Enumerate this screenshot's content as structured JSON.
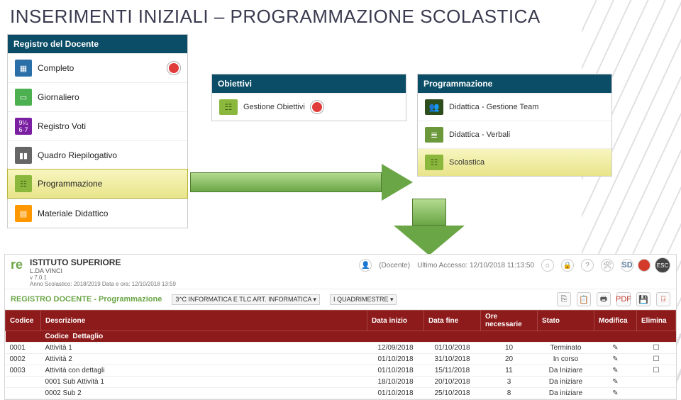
{
  "title": "INSERIMENTI INIZIALI – PROGRAMMAZIONE SCOLASTICA",
  "left_panel": {
    "header": "Registro del Docente",
    "items": [
      {
        "label": "Completo",
        "icon": "cal",
        "new": true
      },
      {
        "label": "Giornaliero",
        "icon": "day"
      },
      {
        "label": "Registro Voti",
        "icon": "v94"
      },
      {
        "label": "Quadro Riepilogativo",
        "icon": "bars"
      },
      {
        "label": "Programmazione",
        "icon": "tree",
        "selected": true
      },
      {
        "label": "Materiale Didattico",
        "icon": "mat"
      }
    ]
  },
  "obiettivi": {
    "header": "Obiettivi",
    "items": [
      {
        "label": "Gestione Obiettivi",
        "icon": "tree",
        "new": true
      }
    ]
  },
  "programmazione": {
    "header": "Programmazione",
    "items": [
      {
        "label": "Didattica - Gestione Team",
        "icon": "team"
      },
      {
        "label": "Didattica - Verbali",
        "icon": "doc"
      },
      {
        "label": "Scolastica",
        "icon": "tree",
        "selected": true
      }
    ]
  },
  "app": {
    "logo": "re",
    "institute": "ISTITUTO SUPERIORE",
    "institute_sub": "L.DA VINCI",
    "version": "v 7.0.1",
    "year_label": "Anno Scolastico: 2018/2019  Data e ora: 12/10/2018 13:59",
    "user_role": "(Docente)",
    "last_access": "Ultimo Accesso: 12/10/2018 11:13:50",
    "top_right": {
      "sd": "SD",
      "esc": "ESC"
    },
    "breadcrumb": "REGISTRO DOCENTE - Programmazione",
    "class_select": "3^C INFORMATICA E TLC ART. INFORMATICA",
    "period": "I QUADRIMESTRE",
    "cols": [
      "Codice",
      "Descrizione",
      "Data inizio",
      "Data fine",
      "Ore necessarie",
      "Stato",
      "Modifica",
      "Elimina"
    ],
    "subcols": [
      "Codice",
      "Dettaglio"
    ],
    "rows": [
      {
        "cod": "0001",
        "desc": "Attività 1",
        "di": "12/09/2018",
        "df": "01/10/2018",
        "ore": "10",
        "stato": "Terminato",
        "mod": "✎",
        "del": "☐"
      },
      {
        "cod": "0002",
        "desc": "Attività 2",
        "di": "01/10/2018",
        "df": "31/10/2018",
        "ore": "20",
        "stato": "In corso",
        "mod": "✎",
        "del": "☐"
      },
      {
        "cod": "0003",
        "desc": "Attività con dettagli",
        "di": "01/10/2018",
        "df": "15/11/2018",
        "ore": "11",
        "stato": "Da Iniziare",
        "mod": "✎",
        "del": "☐"
      },
      {
        "cod": "",
        "desc": "0001   Sub Attività 1",
        "di": "18/10/2018",
        "df": "20/10/2018",
        "ore": "3",
        "stato": "Da iniziare",
        "mod": "✎",
        "del": ""
      },
      {
        "cod": "",
        "desc": "0002   Sub 2",
        "di": "01/10/2018",
        "df": "25/10/2018",
        "ore": "8",
        "stato": "Da iniziare",
        "mod": "✎",
        "del": ""
      }
    ]
  }
}
